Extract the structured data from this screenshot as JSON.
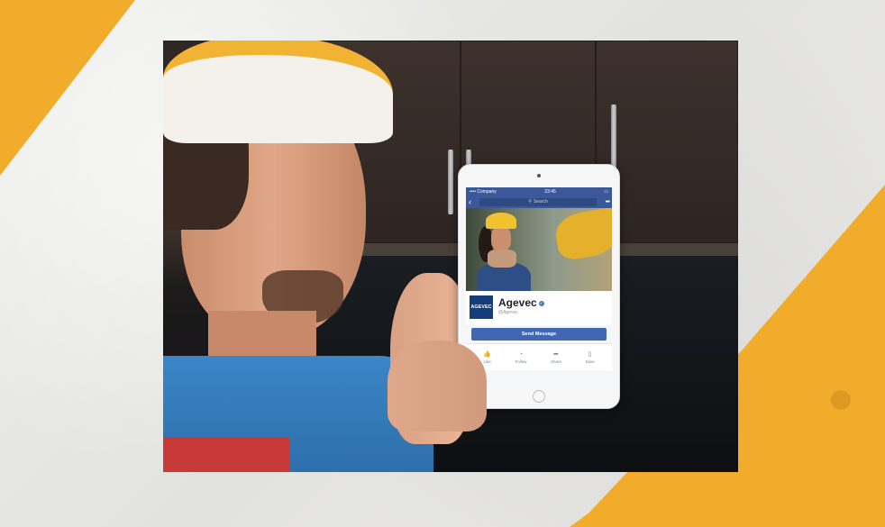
{
  "colors": {
    "accent": "#f2ac2c",
    "facebook_blue": "#3b5998",
    "button_blue": "#4267b2"
  },
  "tablet": {
    "statusbar": {
      "carrier": "•••• Company",
      "time": "23:45"
    },
    "navbar": {
      "back_icon": "chevron-left-icon",
      "search_placeholder": "Search",
      "more_icon": "more-dots-icon"
    },
    "page": {
      "logo_text": "AGEVEC",
      "name": "Agevec",
      "handle": "@Agevec",
      "send_message_label": "Send Message"
    },
    "actions": [
      {
        "label": "Like",
        "icon": "thumbs-up-icon"
      },
      {
        "label": "Follow",
        "icon": "rss-icon"
      },
      {
        "label": "Share",
        "icon": "share-icon"
      },
      {
        "label": "Save",
        "icon": "bookmark-icon"
      }
    ]
  }
}
